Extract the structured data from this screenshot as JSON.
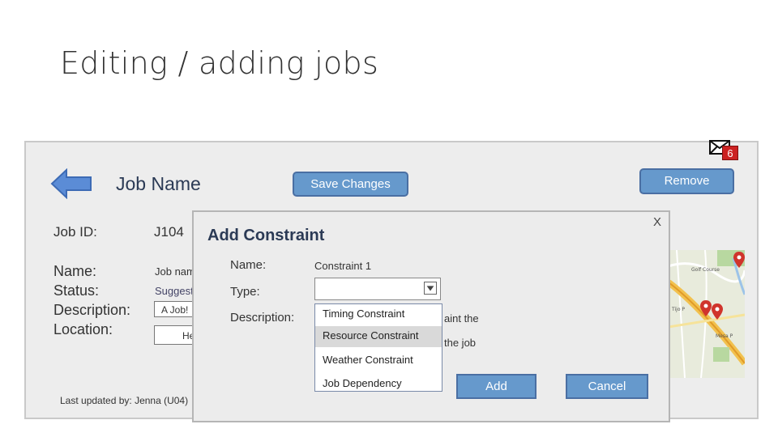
{
  "slide": {
    "title": "Editing / adding jobs"
  },
  "header": {
    "notification_count": "6",
    "job_name_title": "Job Name",
    "save_label": "Save Changes",
    "remove_label": "Remove"
  },
  "details": {
    "job_id_label": "Job ID:",
    "job_id_value": "J104",
    "name_label": "Name:",
    "status_label": "Status:",
    "description_label": "Description:",
    "location_label": "Location:",
    "name_value": "Job nam",
    "status_value": "Suggest",
    "description_value": "A Job!",
    "location_value": "He",
    "last_updated": "Last updated by: Jenna (U04)"
  },
  "dialog": {
    "close_label": "X",
    "title": "Add Constraint",
    "name_label": "Name:",
    "name_value": "Constraint 1",
    "type_label": "Type:",
    "description_label": "Description:",
    "type_options": [
      "Timing Constraint",
      "Resource Constraint",
      "Weather Constraint",
      "Job Dependency"
    ],
    "description_fragment_1": "aint the",
    "description_fragment_2": "the job",
    "add_label": "Add",
    "cancel_label": "Cancel"
  },
  "colors": {
    "button": "#6699cc",
    "panel": "#ededed",
    "badge": "#cc2222"
  }
}
